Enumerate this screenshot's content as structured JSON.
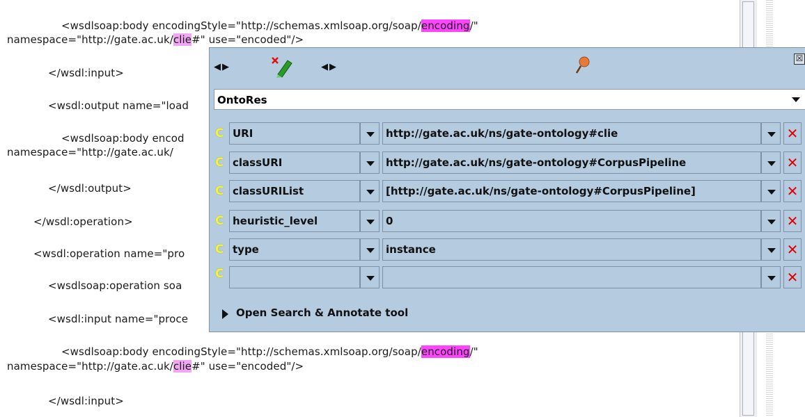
{
  "document": {
    "lines": [
      {
        "pre": "<wsdlsoap:body encodingStyle=\"http://schemas.xmlsoap.org/soap/",
        "hl": "encoding",
        "post": "/\""
      },
      {
        "pre": "namespace=\"http://gate.ac.uk/",
        "hl": "clie",
        "post": "#\" use=\"encoded\"/>"
      },
      {
        "text": "</wsdl:input>"
      },
      {
        "text": "<wsdl:output name=\"load"
      },
      {
        "text": "<wsdlsoap:body encod"
      },
      {
        "text": "namespace=\"http://gate.ac.uk/"
      },
      {
        "text": "</wsdl:output>"
      },
      {
        "text": "</wsdl:operation>"
      },
      {
        "text": "<wsdl:operation name=\"pro"
      },
      {
        "text": "<wsdlsoap:operation soa"
      },
      {
        "text": "<wsdl:input name=\"proce"
      },
      {
        "pre": "<wsdlsoap:body encodingStyle=\"http://schemas.xmlsoap.org/soap/",
        "hl": "encoding",
        "post": "/\""
      },
      {
        "pre": "namespace=\"http://gate.ac.uk/",
        "hl": "clie",
        "post": "#\" use=\"encoded\"/>"
      },
      {
        "text": "</wsdl:input>"
      }
    ]
  },
  "popup": {
    "close_glyph": "☒",
    "nav_arrows": "◀▶",
    "selected_type": "OntoRes",
    "feature_icon_glyph": "C",
    "features": [
      {
        "name": "URI",
        "value": "http://gate.ac.uk/ns/gate-ontology#clie"
      },
      {
        "name": "classURI",
        "value": "http://gate.ac.uk/ns/gate-ontology#CorpusPipeline"
      },
      {
        "name": "classURIList",
        "value": "[http://gate.ac.uk/ns/gate-ontology#CorpusPipeline]"
      },
      {
        "name": "heuristic_level",
        "value": "0"
      },
      {
        "name": "type",
        "value": "instance"
      },
      {
        "name": "",
        "value": ""
      }
    ],
    "delete_glyph": "✕",
    "open_tool_label": "Open Search & Annotate tool"
  },
  "colors": {
    "popup_bg": "#b5cbe0",
    "highlight_strong": "#ff44ff",
    "highlight_soft": "#f2a6f2",
    "delete_red": "#e00000"
  },
  "icons": [
    "close-icon",
    "left-right-arrows-icon",
    "delete-marker-icon",
    "pin-icon",
    "chevron-down-icon",
    "class-c-icon",
    "delete-x-icon",
    "expand-triangle-icon"
  ]
}
